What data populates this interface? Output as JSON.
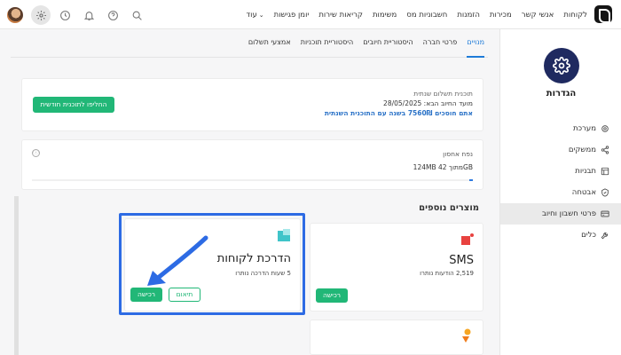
{
  "topbar": {
    "nav_items": [
      "לקוחות",
      "אנשי קשר",
      "מכירות",
      "הזמנות",
      "חשבוניות מס",
      "משימות",
      "קריאות שירות",
      "יומן פגישות"
    ],
    "more_label": "עוד",
    "icons": [
      "search-icon",
      "help-icon",
      "bell-icon",
      "clock-icon",
      "gear-icon",
      "avatar"
    ]
  },
  "sidebar": {
    "title": "הגדרות",
    "items": [
      {
        "label": "מערכת",
        "icon": "gear-icon"
      },
      {
        "label": "ממשקים",
        "icon": "share-icon"
      },
      {
        "label": "תבניות",
        "icon": "template-icon"
      },
      {
        "label": "אבטחה",
        "icon": "shield-icon"
      },
      {
        "label": "פרטי חשבון וחיוב",
        "icon": "card-icon",
        "active": true
      },
      {
        "label": "כלים",
        "icon": "tools-icon"
      }
    ]
  },
  "tabs": [
    {
      "label": "מנויים",
      "active": true
    },
    {
      "label": "פרטי חברה"
    },
    {
      "label": "היסטוריית חיובים"
    },
    {
      "label": "היסטוריית תוכניות"
    },
    {
      "label": "אמצעי תשלום"
    }
  ],
  "plan": {
    "name": "תוכנית תשלום שנתית",
    "next_billing": "מועד החיוב הבא: 28/05/2025",
    "promo": "אתם חוסכים 7560₪ בשנה עם התוכנית השנתית",
    "switch_button": "החליפו לתוכנית חודשית"
  },
  "storage": {
    "title": "נפח אחסון",
    "usage": "124MB מתוך 42GB",
    "info_icon": "ⓘ",
    "fill_fraction": 0.003
  },
  "products": {
    "section_title": "מוצרים נוספים",
    "items": [
      {
        "name": "SMS",
        "subtitle": "2,519 הודעות נותרו",
        "buy": "רכישה",
        "icon": "sms-icon"
      },
      {
        "name": "הדרכת לקוחות",
        "subtitle": "5 שעות הדרכה נותרו",
        "buy": "רכישה",
        "schedule": "תיאום",
        "icon": "training-icon"
      }
    ]
  },
  "colors": {
    "accent": "#1e7bd8",
    "green": "#21b777",
    "highlight": "#2d6be4",
    "brand": "#1f2a60"
  }
}
